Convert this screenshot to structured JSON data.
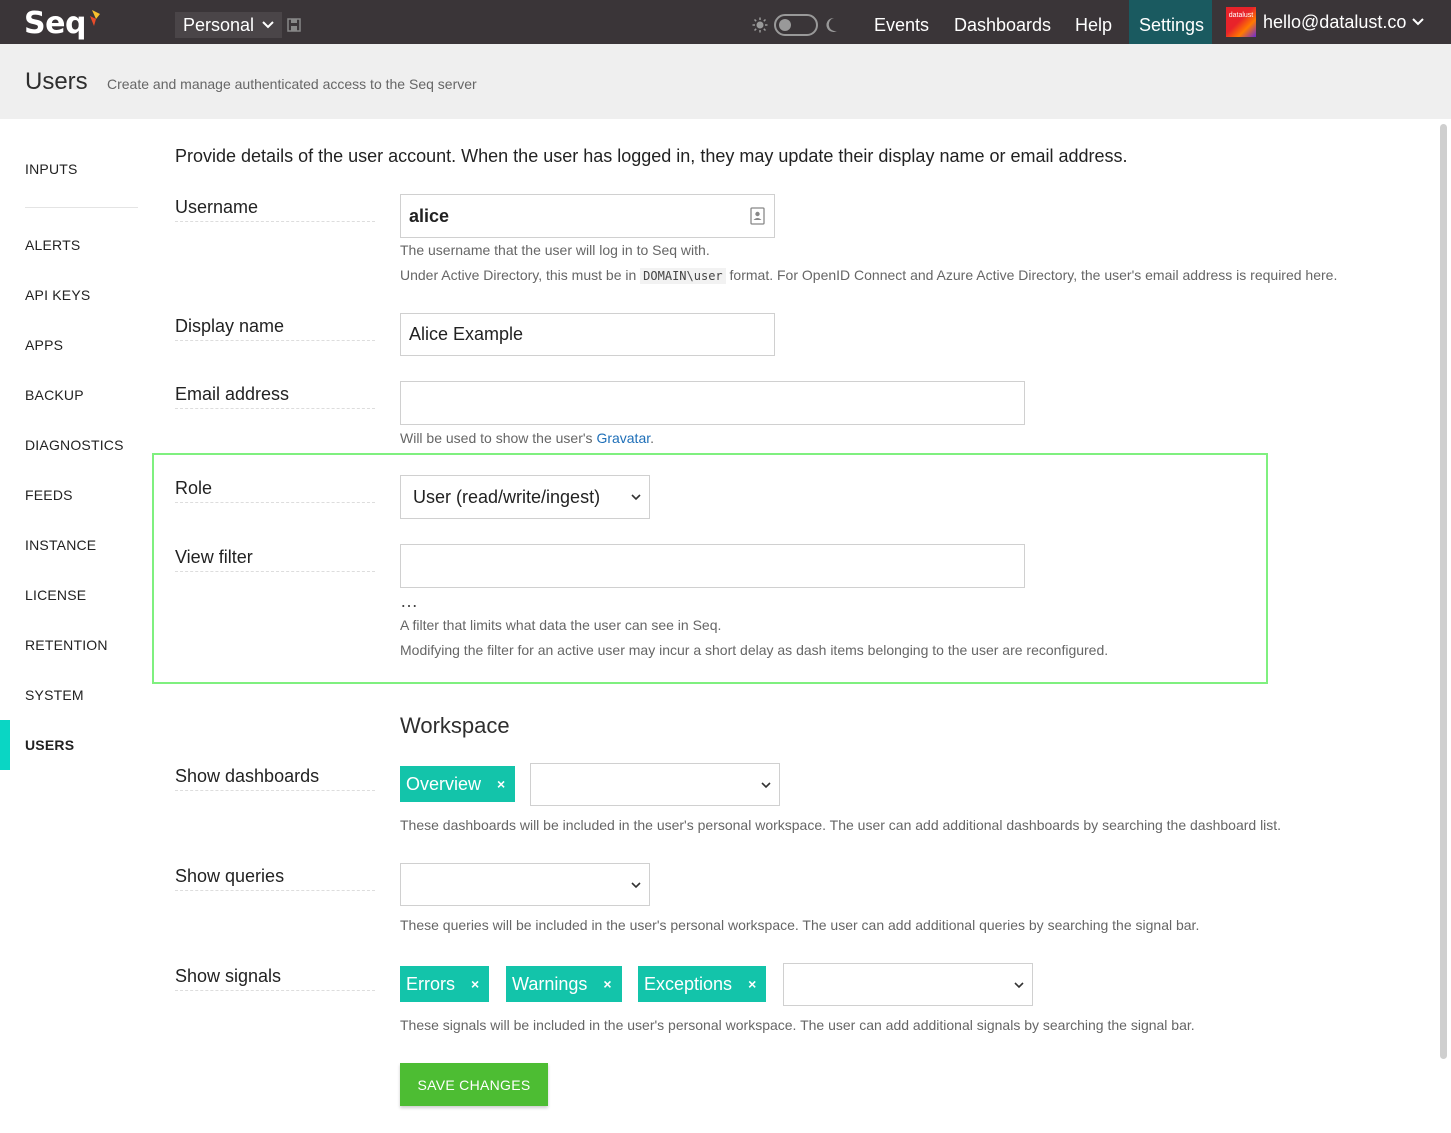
{
  "topbar": {
    "logo": "Seq",
    "workspace": "Personal",
    "nav": {
      "events": "Events",
      "dashboards": "Dashboards",
      "help": "Help",
      "settings": "Settings"
    },
    "avatar_text": "datalust",
    "user_email": "hello@datalust.co",
    "accent_color": "#1a5a60"
  },
  "header": {
    "title": "Users",
    "subtitle": "Create and manage authenticated access to the Seq server"
  },
  "sidebar": {
    "items": [
      {
        "label": "INPUTS"
      },
      {
        "label": "ALERTS"
      },
      {
        "label": "API KEYS"
      },
      {
        "label": "APPS"
      },
      {
        "label": "BACKUP"
      },
      {
        "label": "DIAGNOSTICS"
      },
      {
        "label": "FEEDS"
      },
      {
        "label": "INSTANCE"
      },
      {
        "label": "LICENSE"
      },
      {
        "label": "RETENTION"
      },
      {
        "label": "SYSTEM"
      },
      {
        "label": "USERS",
        "active": true
      }
    ],
    "active_color": "#0ad6c4"
  },
  "form": {
    "intro": "Provide details of the user account. When the user has logged in, they may update their display name or email address.",
    "username": {
      "label": "Username",
      "value": "alice",
      "help1": "The username that the user will log in to Seq with.",
      "help2_pre": "Under Active Directory, this must be in ",
      "help2_code": "DOMAIN\\user",
      "help2_post": " format. For OpenID Connect and Azure Active Directory, the user's email address is required here."
    },
    "display_name": {
      "label": "Display name",
      "value": "Alice Example"
    },
    "email": {
      "label": "Email address",
      "value": "",
      "help_pre": "Will be used to show the user's ",
      "help_link": "Gravatar",
      "help_post": "."
    },
    "role": {
      "label": "Role",
      "value": "User (read/write/ingest)"
    },
    "view_filter": {
      "label": "View filter",
      "value": "",
      "ellipsis": "…",
      "help1": "A filter that limits what data the user can see in Seq.",
      "help2": "Modifying the filter for an active user may incur a short delay as dash items belonging to the user are reconfigured."
    },
    "workspace": {
      "title": "Workspace",
      "dashboards": {
        "label": "Show dashboards",
        "chips": [
          "Overview"
        ],
        "help": "These dashboards will be included in the user's personal workspace. The user can add additional dashboards by searching the dashboard list."
      },
      "queries": {
        "label": "Show queries",
        "help": "These queries will be included in the user's personal workspace. The user can add additional queries by searching the signal bar."
      },
      "signals": {
        "label": "Show signals",
        "chips": [
          "Errors",
          "Warnings",
          "Exceptions"
        ],
        "help": "These signals will be included in the user's personal workspace. The user can add additional signals by searching the signal bar."
      }
    },
    "chip_remove": "×",
    "chip_color": "#13c4aa",
    "save_label": "SAVE CHANGES",
    "save_color": "#4dbd33"
  }
}
